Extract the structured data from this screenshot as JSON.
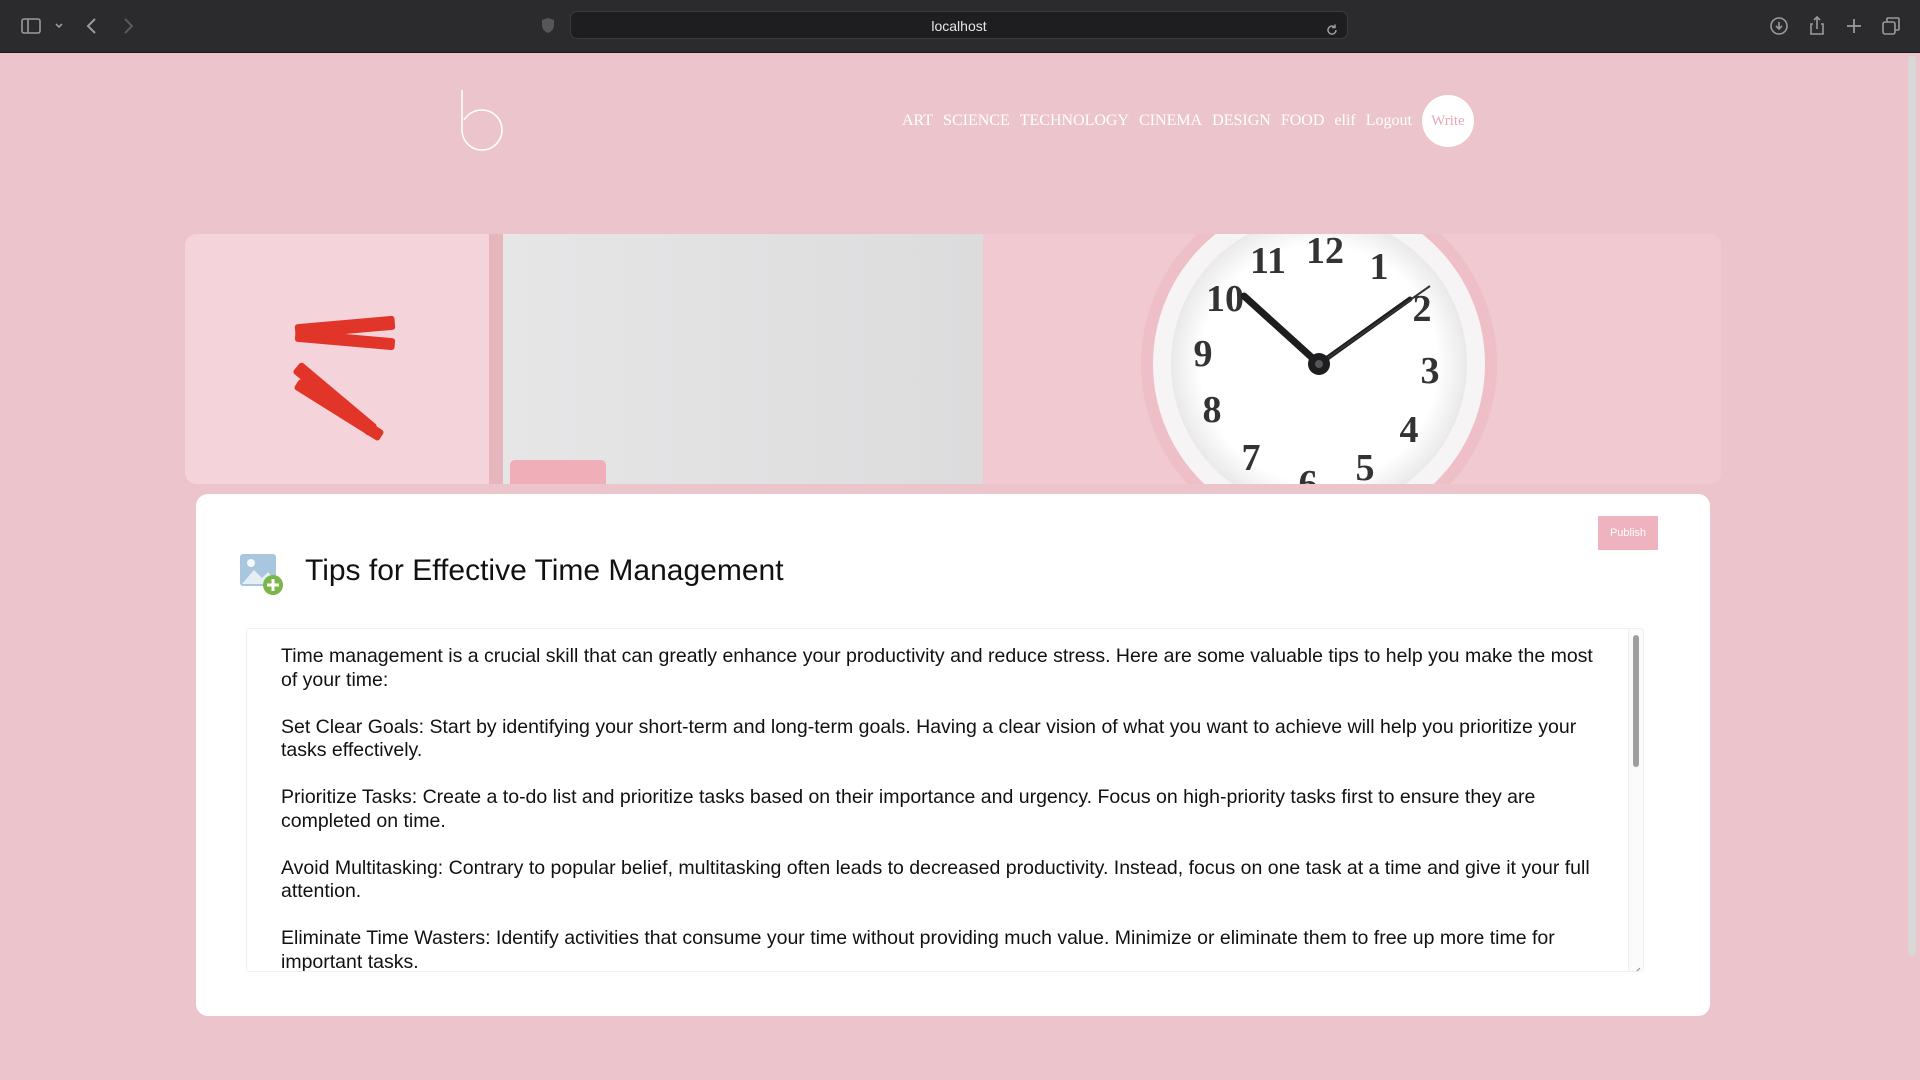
{
  "browser": {
    "url": "localhost"
  },
  "nav": {
    "items": [
      "ART",
      "SCIENCE",
      "TECHNOLOGY",
      "CINEMA",
      "DESIGN",
      "FOOD",
      "elif",
      "Logout"
    ],
    "write_label": "Write"
  },
  "editor": {
    "publish_label": "Publish",
    "title": "Tips for Effective Time Management",
    "paragraphs": [
      "Time management is a crucial skill that can greatly enhance your productivity and reduce stress. Here are some valuable tips to help you make the most of your time:",
      "Set Clear Goals: Start by identifying your short-term and long-term goals. Having a clear vision of what you want to achieve will help you prioritize your tasks effectively.",
      "Prioritize Tasks: Create a to-do list and prioritize tasks based on their importance and urgency. Focus on high-priority tasks first to ensure they are completed on time.",
      "Avoid Multitasking: Contrary to popular belief, multitasking often leads to decreased productivity. Instead, focus on one task at a time and give it your full attention.",
      "Eliminate Time Wasters: Identify activities that consume your time without providing much value. Minimize or eliminate them to free up more time for important tasks."
    ]
  },
  "colors": {
    "page_bg": "#ecc5cc",
    "accent": "#eeb3bf",
    "clock_numbers": [
      "11",
      "12",
      "1",
      "10",
      "2",
      "9",
      "3",
      "8",
      "4",
      "7",
      "6",
      "5"
    ]
  }
}
